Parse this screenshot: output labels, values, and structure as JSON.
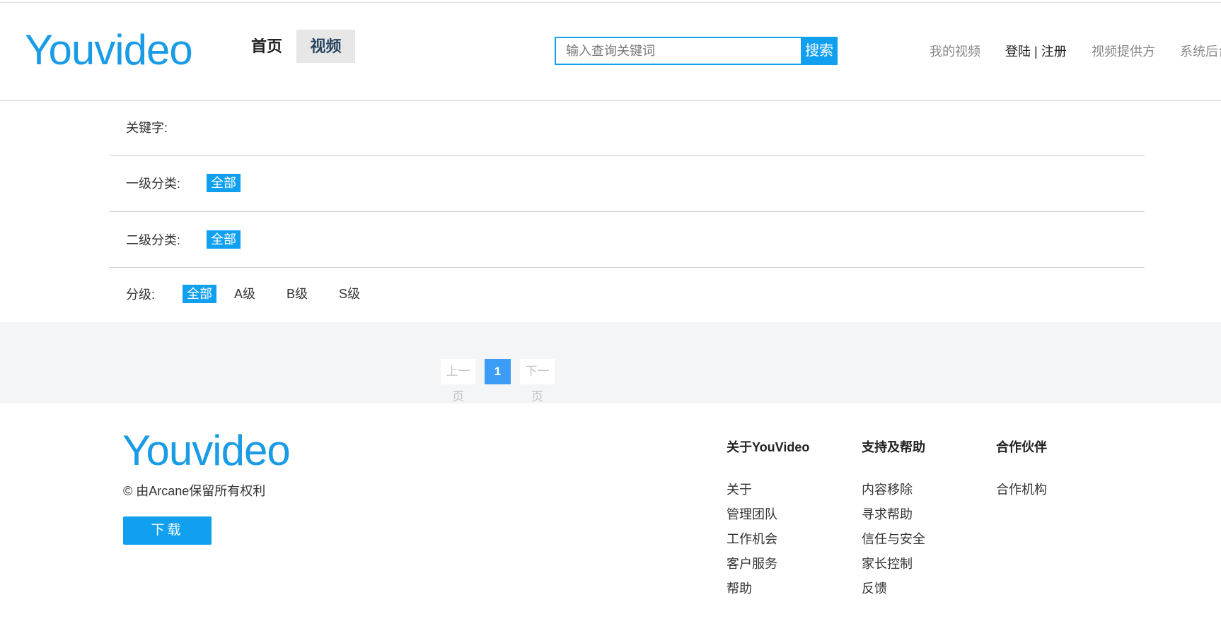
{
  "header": {
    "logo": "Youvideo",
    "nav": {
      "home": "首页",
      "video": "视频"
    },
    "search": {
      "placeholder": "输入查询关键词",
      "button": "搜索"
    },
    "links": {
      "my_video": "我的视频",
      "login": "登陆",
      "separator": "|",
      "register": "注册",
      "provider": "视频提供方",
      "admin": "系统后台"
    }
  },
  "filters": {
    "keyword_label": "关键字:",
    "level1_label": "一级分类:",
    "level1_selected": "全部",
    "level2_label": "二级分类:",
    "level2_selected": "全部",
    "grade_label": "分级:",
    "grade_options": [
      "全部",
      "A级",
      "B级",
      "S级"
    ]
  },
  "pagination": {
    "prev": "上一页",
    "current": "1",
    "next": "下一页"
  },
  "footer": {
    "logo": "Youvideo",
    "copyright": "© 由Arcane保留所有权利",
    "download": "下载",
    "columns": [
      {
        "title": "关于YouVideo",
        "items": [
          "关于",
          "管理团队",
          "工作机会",
          "客户服务",
          "帮助"
        ]
      },
      {
        "title": "支持及帮助",
        "items": [
          "内容移除",
          "寻求帮助",
          "信任与安全",
          "家长控制",
          "反馈"
        ]
      },
      {
        "title": "合作伙伴",
        "items": [
          "合作机构"
        ]
      }
    ]
  },
  "colors": {
    "accent": "#11a0f0",
    "logo": "#1a9be6",
    "band": "#f4f5f7",
    "page_active": "#3d9df6"
  }
}
